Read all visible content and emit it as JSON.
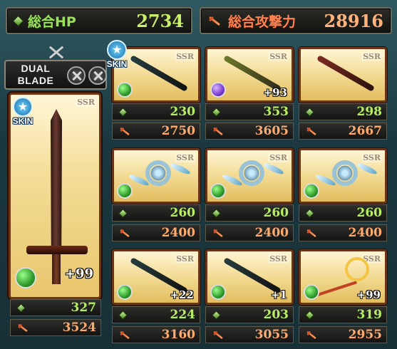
{
  "totals": {
    "hp_label": "総合HP",
    "hp_value": "2734",
    "atk_label": "総合攻撃力",
    "atk_value": "28916"
  },
  "weapon_class": {
    "label_line1": "DUAL",
    "label_line2": "BLADE"
  },
  "skin_label": "SKIN",
  "rarity_label": "SSR",
  "main_weapon": {
    "plus": "+99",
    "hp": "327",
    "atk": "3524"
  },
  "grid": [
    {
      "plus": "",
      "hp": "230",
      "atk": "2750",
      "element": "wind",
      "skin": true
    },
    {
      "plus": "+93",
      "hp": "353",
      "atk": "3605",
      "element": "dark",
      "skin": false
    },
    {
      "plus": "",
      "hp": "298",
      "atk": "2667",
      "element": "none",
      "skin": false
    },
    {
      "plus": "",
      "hp": "260",
      "atk": "2400",
      "element": "wind",
      "skin": false
    },
    {
      "plus": "",
      "hp": "260",
      "atk": "2400",
      "element": "wind",
      "skin": false
    },
    {
      "plus": "",
      "hp": "260",
      "atk": "2400",
      "element": "wind",
      "skin": false
    },
    {
      "plus": "+22",
      "hp": "224",
      "atk": "3160",
      "element": "wind",
      "skin": false
    },
    {
      "plus": "+1",
      "hp": "203",
      "atk": "3055",
      "element": "wind",
      "skin": false
    },
    {
      "plus": "+99",
      "hp": "319",
      "atk": "2955",
      "element": "wind",
      "skin": false
    }
  ]
}
